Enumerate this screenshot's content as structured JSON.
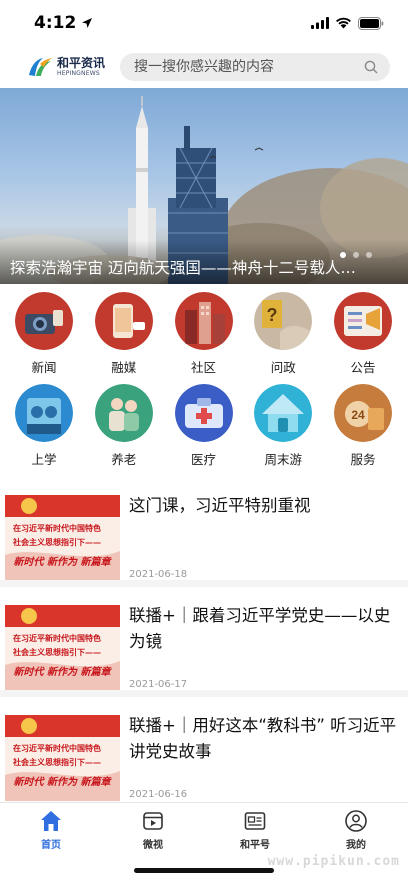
{
  "status_bar": {
    "time": "4:12"
  },
  "header": {
    "logo_cn": "和平资讯",
    "logo_en": "HEPINGNEWS",
    "search_placeholder": "搜一搜你感兴趣的内容"
  },
  "banner": {
    "caption": "探索浩瀚宇宙 迈向航天强国——神舟十二号载人…",
    "dots": 3,
    "active_dot": 1
  },
  "categories": [
    {
      "label": "新闻",
      "icon": "news-icon",
      "color": "#c0392b"
    },
    {
      "label": "融媒",
      "icon": "media-icon",
      "color": "#c0392b"
    },
    {
      "label": "社区",
      "icon": "community-icon",
      "color": "#c0392b"
    },
    {
      "label": "问政",
      "icon": "inquiry-icon",
      "color": "#c0392b"
    },
    {
      "label": "公告",
      "icon": "announcement-icon",
      "color": "#c0392b"
    },
    {
      "label": "上学",
      "icon": "school-icon",
      "color": "#2a8fd6"
    },
    {
      "label": "养老",
      "icon": "elderly-care-icon",
      "color": "#2aa07a"
    },
    {
      "label": "医疗",
      "icon": "medical-icon",
      "color": "#3a5fc8"
    },
    {
      "label": "周末游",
      "icon": "weekend-travel-icon",
      "color": "#2ab0d6"
    },
    {
      "label": "服务",
      "icon": "service-icon",
      "color": "#c87a3a"
    }
  ],
  "news": [
    {
      "title": "这门课，习近平特别重视",
      "date": "2021-06-18",
      "thumb_lines": [
        "在习近平新时代中国特色",
        "社会主义思想指引下——",
        "新时代 新作为 新篇章"
      ]
    },
    {
      "title": "联播+｜跟着习近平学党史——以史为镜",
      "date": "2021-06-17",
      "thumb_lines": [
        "在习近平新时代中国特色",
        "社会主义思想指引下——",
        "新时代 新作为 新篇章"
      ]
    },
    {
      "title": "联播+｜用好这本“教科书” 听习近平讲党史故事",
      "date": "2021-06-16",
      "thumb_lines": [
        "在习近平新时代中国特色",
        "社会主义思想指引下——",
        "新时代 新作为 新篇章"
      ]
    }
  ],
  "tabbar": [
    {
      "label": "首页",
      "icon": "home-icon",
      "active": true
    },
    {
      "label": "微视",
      "icon": "video-icon",
      "active": false
    },
    {
      "label": "和平号",
      "icon": "news-feed-icon",
      "active": false
    },
    {
      "label": "我的",
      "icon": "profile-icon",
      "active": false
    }
  ],
  "watermark": "www.pipikun.com",
  "colors": {
    "accent": "#2f6fdf",
    "party_red": "#c8161d"
  }
}
